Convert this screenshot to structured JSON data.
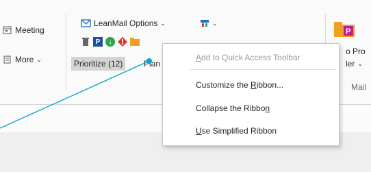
{
  "ribbon": {
    "meeting_label": "Meeting",
    "more_label": "More",
    "leanmail_label": "LeanMail Options",
    "prioritize_label": "Prioritize (12)",
    "plan_label": "Plan",
    "right_partial_1": "o Pro",
    "right_partial_2": "ler",
    "right_partial_3": "Mail"
  },
  "context_menu": {
    "items": [
      {
        "pre": "",
        "ul": "A",
        "post": "dd to Quick Access Toolbar",
        "enabled": false
      },
      {
        "pre": "Customize the ",
        "ul": "R",
        "post": "ibbon...",
        "enabled": true
      },
      {
        "pre": "Collapse the Ribbo",
        "ul": "n",
        "post": "",
        "enabled": true
      },
      {
        "pre": "",
        "ul": "U",
        "post": "se Simplified Ribbon",
        "enabled": true
      }
    ]
  },
  "colors": {
    "accent": "#0aa6c9",
    "leanmail_blue": "#1f6fbf",
    "folder_orange": "#f0a020",
    "menu_text": "#262626",
    "disabled_text": "#9a9a9a"
  }
}
